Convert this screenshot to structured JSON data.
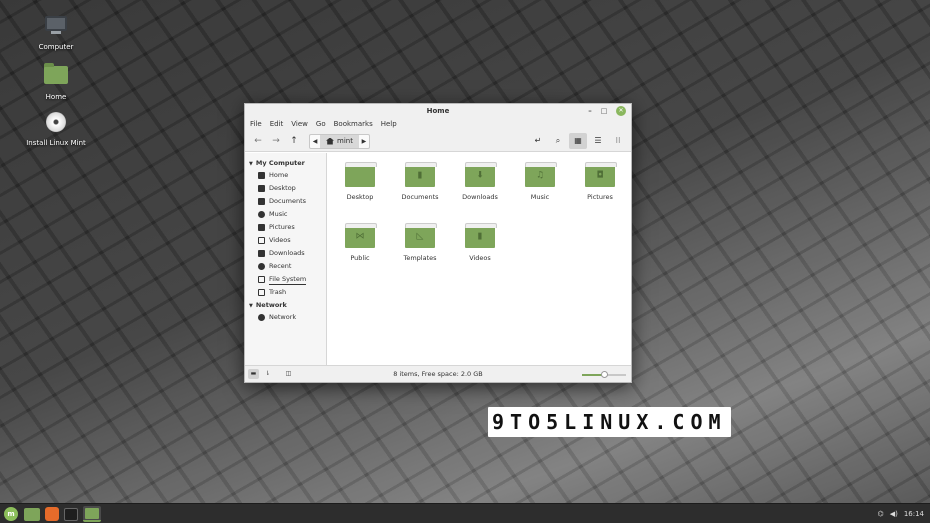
{
  "desktop": {
    "icons": [
      {
        "label": "Computer",
        "icon": "computer-icon"
      },
      {
        "label": "Home",
        "icon": "home-folder-icon"
      },
      {
        "label": "Install Linux Mint",
        "icon": "disc-icon"
      }
    ]
  },
  "window": {
    "title": "Home",
    "menu": [
      "File",
      "Edit",
      "View",
      "Go",
      "Bookmarks",
      "Help"
    ],
    "pathbar": {
      "current": "mint"
    },
    "sidebar": {
      "sections": [
        {
          "title": "My Computer",
          "items": [
            {
              "label": "Home",
              "icon": "home-icon"
            },
            {
              "label": "Desktop",
              "icon": "desktop-icon"
            },
            {
              "label": "Documents",
              "icon": "document-icon"
            },
            {
              "label": "Music",
              "icon": "music-icon"
            },
            {
              "label": "Pictures",
              "icon": "camera-icon"
            },
            {
              "label": "Videos",
              "icon": "film-icon"
            },
            {
              "label": "Downloads",
              "icon": "download-icon"
            },
            {
              "label": "Recent",
              "icon": "clock-icon"
            },
            {
              "label": "File System",
              "icon": "drive-icon"
            },
            {
              "label": "Trash",
              "icon": "trash-icon"
            }
          ]
        },
        {
          "title": "Network",
          "items": [
            {
              "label": "Network",
              "icon": "globe-icon"
            }
          ]
        }
      ]
    },
    "folders": [
      {
        "label": "Desktop",
        "emblem": ""
      },
      {
        "label": "Documents",
        "emblem": "▮"
      },
      {
        "label": "Downloads",
        "emblem": "⬇"
      },
      {
        "label": "Music",
        "emblem": "♫"
      },
      {
        "label": "Pictures",
        "emblem": "◘"
      },
      {
        "label": "Public",
        "emblem": "⋈"
      },
      {
        "label": "Templates",
        "emblem": "◺"
      },
      {
        "label": "Videos",
        "emblem": "▮"
      }
    ],
    "status": "8 items, Free space: 2.0 GB",
    "zoom_level": 0.5
  },
  "watermark": {
    "text": "9TO5LINUX.COM"
  },
  "taskbar": {
    "apps": [
      "menu-icon",
      "show-desktop-icon",
      "firefox-icon",
      "terminal-icon",
      "files-icon"
    ],
    "clock": "16:14"
  },
  "colors": {
    "accent": "#7ea55a",
    "panel": "#2d2d2d"
  }
}
